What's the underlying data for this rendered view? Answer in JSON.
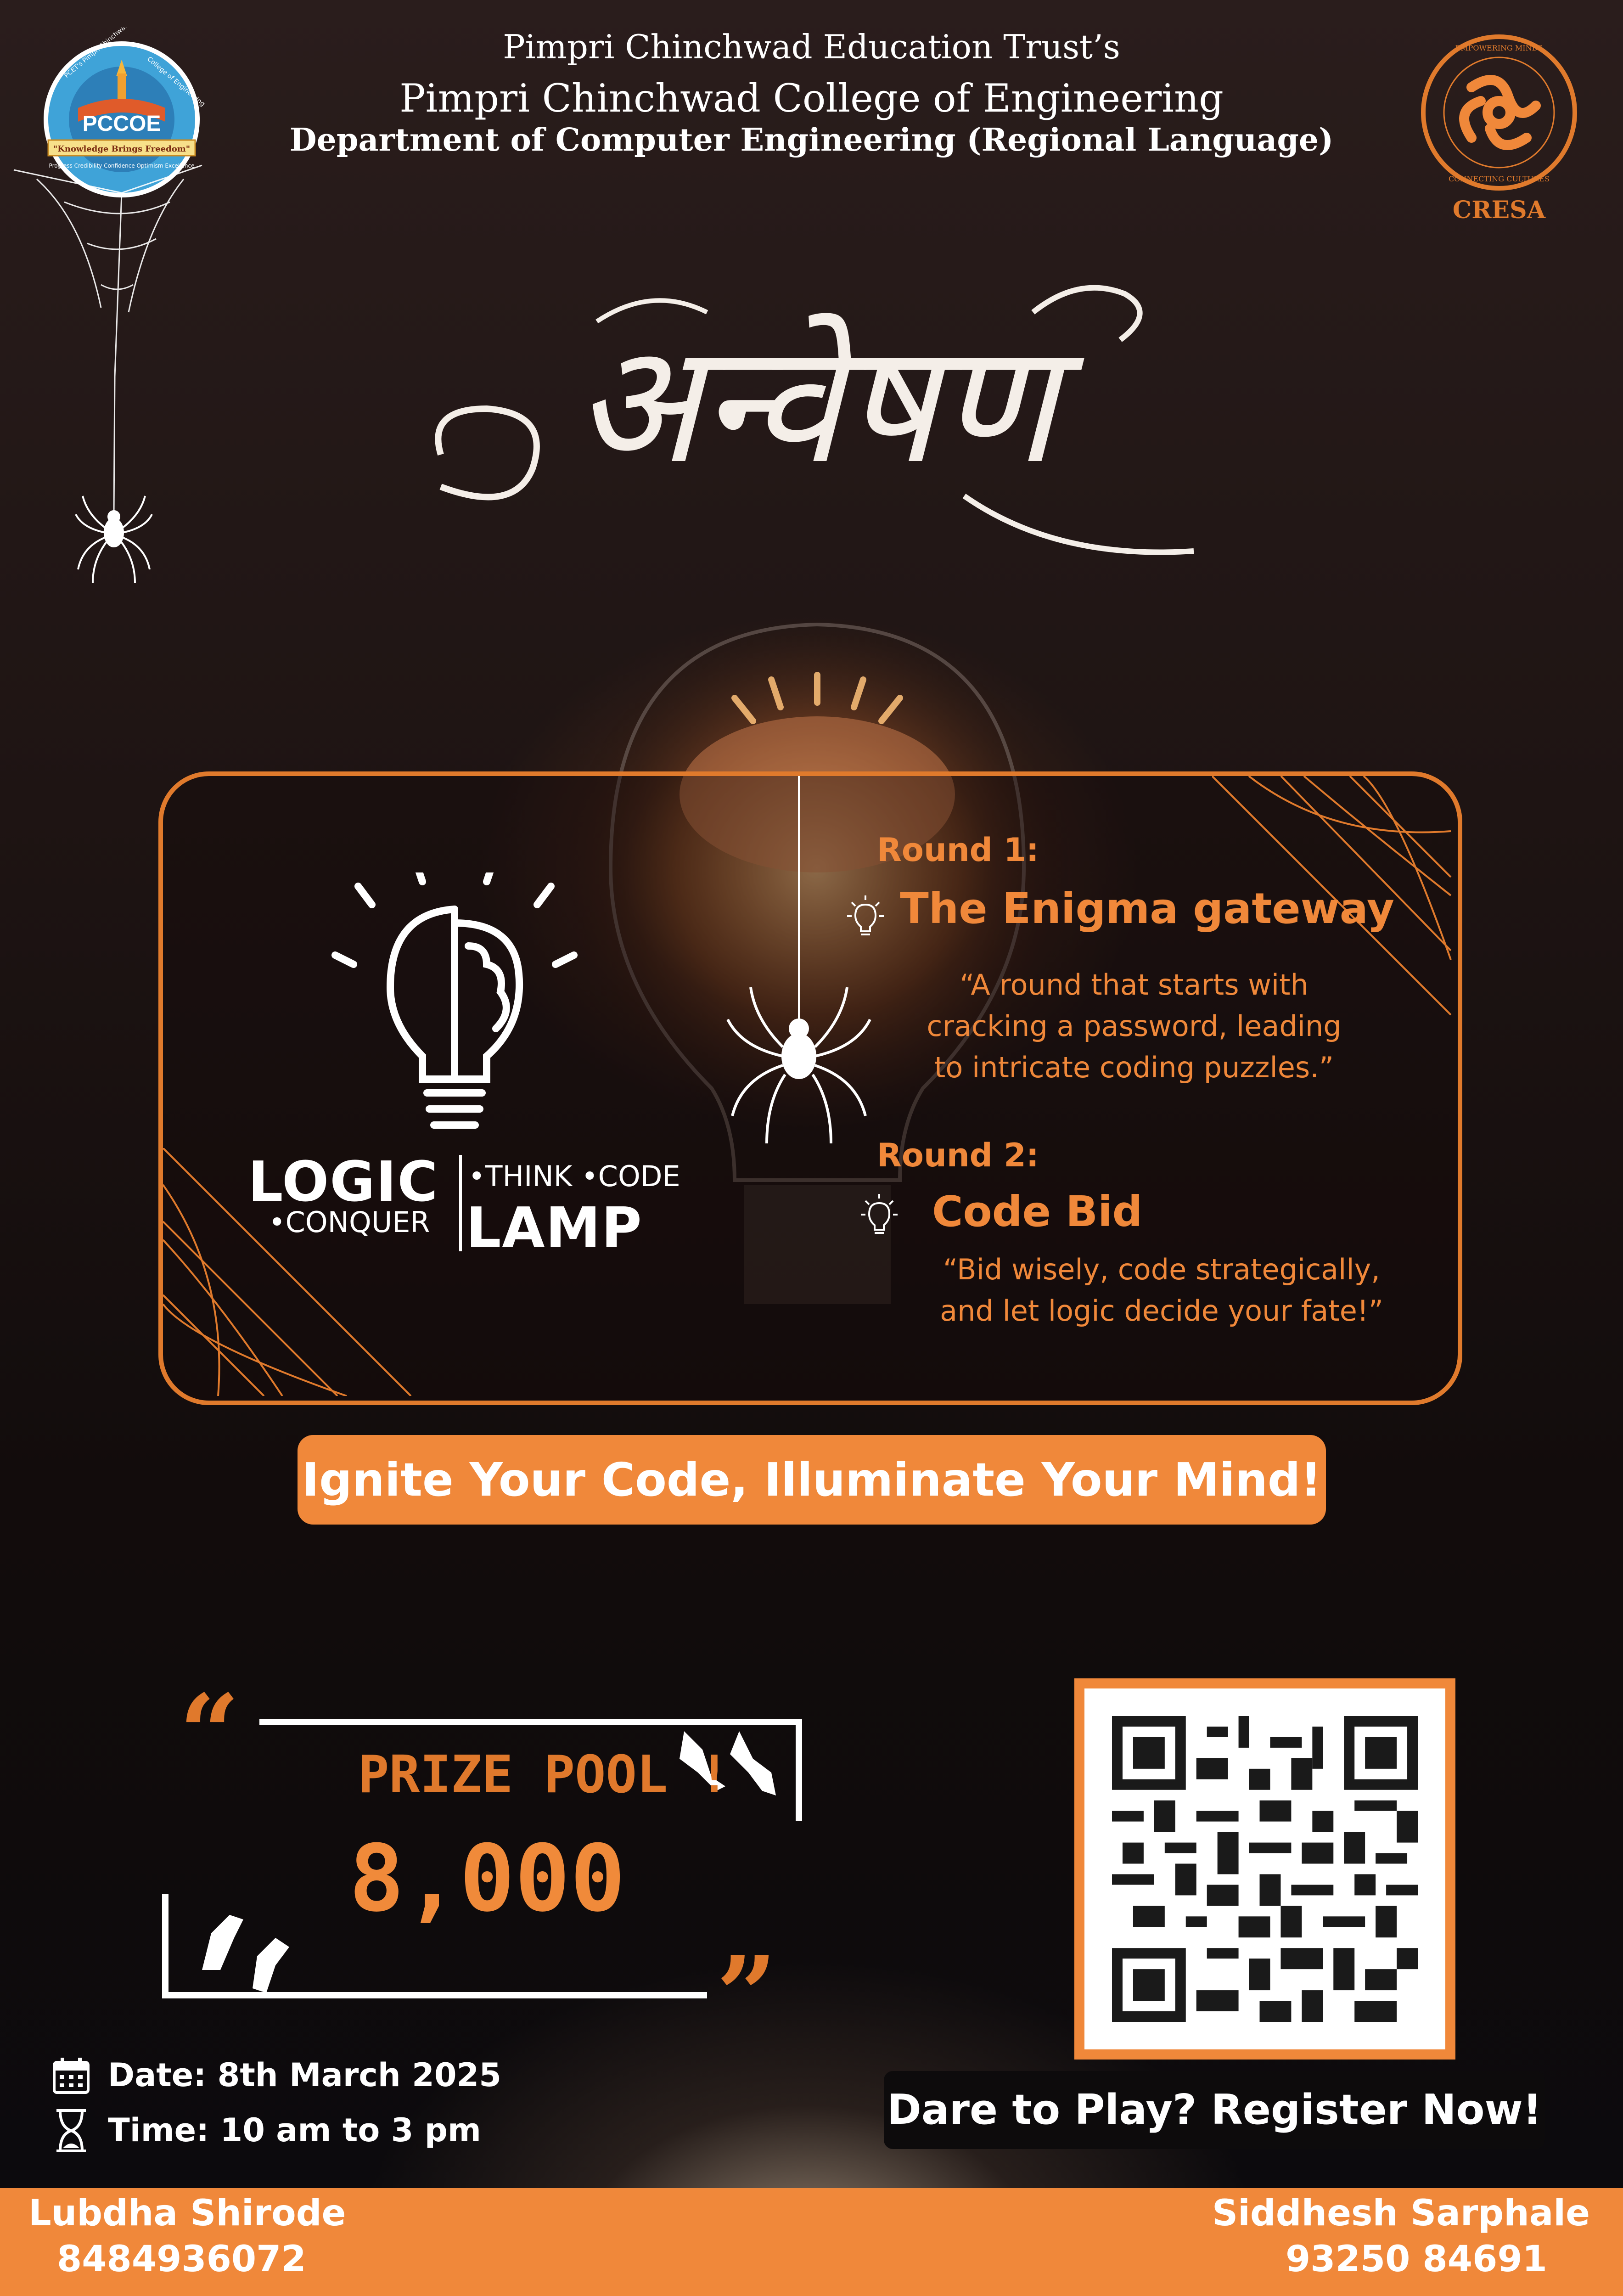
{
  "header": {
    "trust": "Pimpri Chinchwad Education Trust’s",
    "college": "Pimpri Chinchwad College of Engineering",
    "department": "Department of Computer Engineering  (Regional Language)"
  },
  "logos": {
    "pccoe": {
      "abbr": "PCCOE",
      "motto": "\"Knowledge Brings Freedom\"",
      "ring_left": "PCET's Pimpri Chinchwad",
      "ring_right": "College of Engineering",
      "values": "Progress Credibility Confidence Optimism Excellence"
    },
    "cresa": {
      "name": "CRESA",
      "ring_top": "EMPOWERING MINDS",
      "ring_bottom": "CONNECTING CULTURES"
    }
  },
  "event_title": "अन्वेषण",
  "logic_lamp": {
    "word1": "LOGIC",
    "word2": "LAMP",
    "tag1": "•THINK •CODE",
    "tag2": "•CONQUER"
  },
  "rounds": [
    {
      "label": "Round 1:",
      "title": "The Enigma gateway",
      "desc_lines": [
        "“A round that starts with",
        "cracking a password, leading",
        "to intricate coding puzzles.”"
      ]
    },
    {
      "label": "Round 2:",
      "title": "Code Bid",
      "desc_lines": [
        "“Bid wisely, code strategically,",
        "and let logic decide your fate!”"
      ]
    }
  ],
  "tagline": "Ignite Your Code, Illuminate Your Mind!",
  "prize": {
    "label": "PRIZE POOL !",
    "value": "8,000",
    "open_quote": "“",
    "close_quote": "”"
  },
  "event_info": {
    "date": "Date: 8th March 2025",
    "time": "Time: 10 am to 3 pm"
  },
  "register": "Dare to Play? Register Now!",
  "contacts": [
    {
      "name": "Lubdha Shirode",
      "phone": "8484936072"
    },
    {
      "name": "Siddhesh Sarphale",
      "phone": "93250 84691"
    }
  ],
  "colors": {
    "accent": "#f0883a",
    "background": "#1a0f0e",
    "text": "#ffffff"
  }
}
